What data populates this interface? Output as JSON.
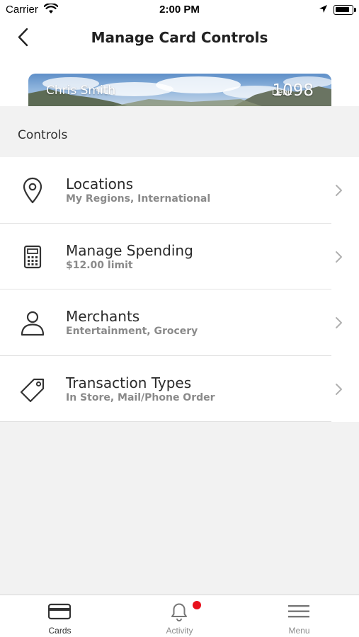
{
  "status_bar": {
    "carrier": "Carrier",
    "time": "2:00 PM"
  },
  "header": {
    "title": "Manage Card Controls",
    "back_icon": "chevron-left-icon"
  },
  "card": {
    "name": "Chris Smith",
    "type": "Debit",
    "last4": "1098"
  },
  "section": {
    "title": "Controls"
  },
  "controls": [
    {
      "icon": "location-pin-icon",
      "title": "Locations",
      "subtitle": "My Regions, International"
    },
    {
      "icon": "calculator-icon",
      "title": "Manage Spending",
      "subtitle": "$12.00 limit"
    },
    {
      "icon": "person-icon",
      "title": "Merchants",
      "subtitle": "Entertainment, Grocery"
    },
    {
      "icon": "tag-icon",
      "title": "Transaction Types",
      "subtitle": "In Store, Mail/Phone Order"
    }
  ],
  "tab_bar": {
    "tabs": [
      {
        "label": "Cards",
        "icon": "card-icon",
        "active": true
      },
      {
        "label": "Activity",
        "icon": "bell-icon",
        "active": false,
        "badge": true
      },
      {
        "label": "Menu",
        "icon": "hamburger-menu-icon",
        "active": false
      }
    ]
  },
  "colors": {
    "badge": "#e8111d",
    "background": "#f2f2f2",
    "row_background": "#ffffff"
  }
}
